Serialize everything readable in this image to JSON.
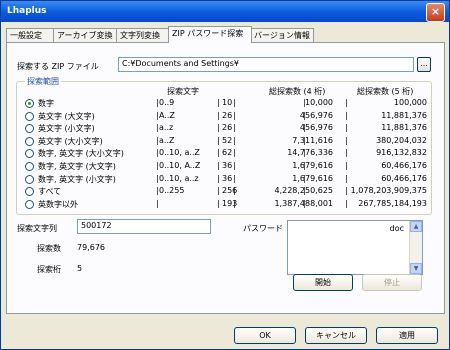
{
  "window": {
    "title": "Lhaplus",
    "close_label": "×"
  },
  "tabs": [
    {
      "label": "一般設定"
    },
    {
      "label": "アーカイブ変換"
    },
    {
      "label": "文字列変換"
    },
    {
      "label": "ZIP パスワード探索"
    },
    {
      "label": "バージョン情報"
    }
  ],
  "search": {
    "file_label": "探索する ZIP ファイル",
    "file_value": "C:¥Documents and Settings¥",
    "browse_label": "..."
  },
  "range": {
    "legend": "探索範囲",
    "headers": {
      "chars": "探索文字",
      "total4": "総探索数 (4 桁)",
      "total5": "総探索数 (5 桁)"
    },
    "selected_index": 0,
    "rows": [
      {
        "label": "数字",
        "chars": "0..9",
        "count": "10",
        "total4": "10,000",
        "total5": "100,000"
      },
      {
        "label": "英文字 (大文字)",
        "chars": "A..Z",
        "count": "26",
        "total4": "456,976",
        "total5": "11,881,376"
      },
      {
        "label": "英文字 (小文字)",
        "chars": "a..z",
        "count": "26",
        "total4": "456,976",
        "total5": "11,881,376"
      },
      {
        "label": "英文字 (大小文字)",
        "chars": "a..Z",
        "count": "52",
        "total4": "7,311,616",
        "total5": "380,204,032"
      },
      {
        "label": "数字, 英文字 (大小文字)",
        "chars": "0..10, a..Z",
        "count": "62",
        "total4": "14,776,336",
        "total5": "916,132,832"
      },
      {
        "label": "数字, 英文字 (大文字)",
        "chars": "0..10, A..Z",
        "count": "36",
        "total4": "1,679,616",
        "total5": "60,466,176"
      },
      {
        "label": "数字, 英文字 (小文字)",
        "chars": "0..10, a..z",
        "count": "36",
        "total4": "1,679,616",
        "total5": "60,466,176"
      },
      {
        "label": "すべて",
        "chars": "0..255",
        "count": "256",
        "total4": "4,228,250,625",
        "total5": "1,078,203,909,375"
      },
      {
        "label": "英数字以外",
        "chars": "",
        "count": "193",
        "total4": "1,387,488,001",
        "total5": "267,785,184,193"
      }
    ]
  },
  "progress": {
    "string_label": "探索文字列",
    "string_value": "500172",
    "count_label": "探索数",
    "count_value": "79,676",
    "digits_label": "探索桁",
    "digits_value": "5",
    "password_label": "パスワード",
    "password_text": "doc",
    "start_label": "開始",
    "stop_label": "停止"
  },
  "footer": {
    "ok_label": "OK",
    "cancel_label": "キャンセル",
    "apply_label": "適用"
  },
  "colors": {
    "title_bar": "#0a5adf",
    "accent_blue": "#1f4fa8",
    "radio_dot": "#21a121"
  }
}
